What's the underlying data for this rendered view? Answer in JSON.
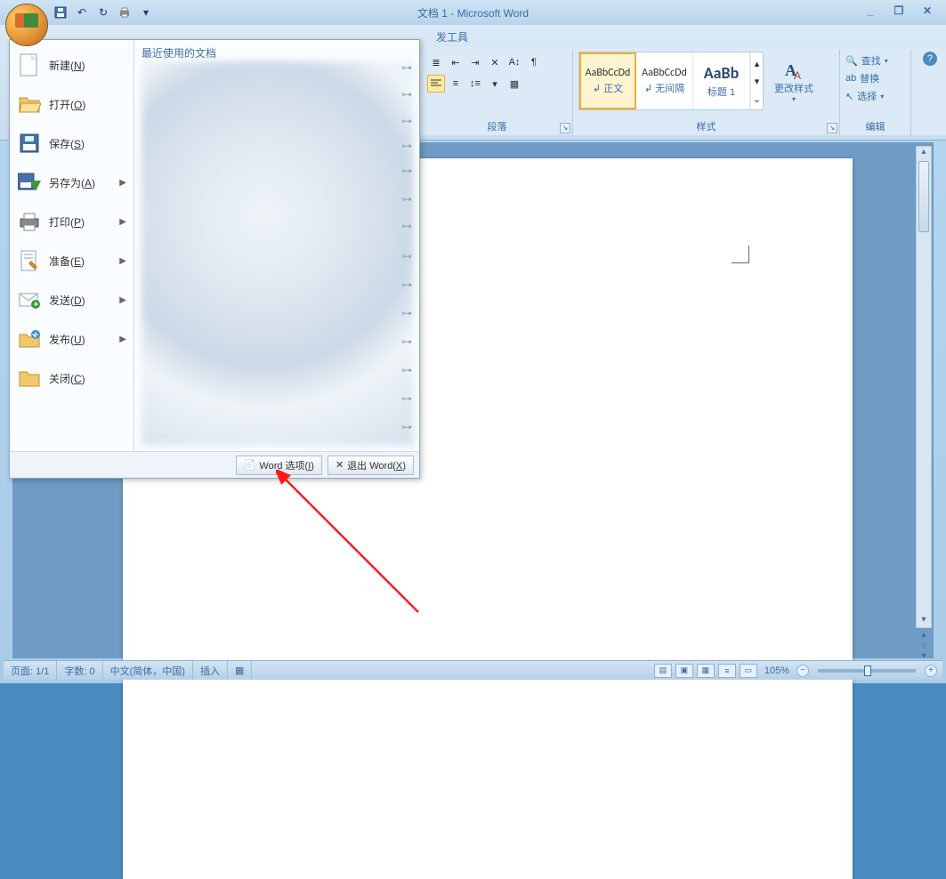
{
  "title": "文档 1 - Microsoft Word",
  "qat": {
    "save": "保存",
    "undo": "撤销",
    "redo": "恢复",
    "quick_print": "快速打印"
  },
  "ribbon": {
    "tab_visible": "发工具",
    "paragraph_label": "段落",
    "styles_label": "样式",
    "edit_label": "编辑",
    "styles": [
      {
        "sample": "AaBbCcDd",
        "name": "↲ 正文"
      },
      {
        "sample": "AaBbCcDd",
        "name": "↲ 无间隔"
      },
      {
        "sample": "AaBb",
        "name": "标题 1"
      }
    ],
    "change_style": "更改样式",
    "find": "查找",
    "replace": "替换",
    "select": "选择"
  },
  "help_tip": "?",
  "office_menu": {
    "recent_title": "最近使用的文档",
    "items": [
      {
        "label": "新建(N)"
      },
      {
        "label": "打开(O)"
      },
      {
        "label": "保存(S)"
      },
      {
        "label": "另存为(A)",
        "arrow": true
      },
      {
        "label": "打印(P)",
        "arrow": true
      },
      {
        "label": "准备(E)",
        "arrow": true
      },
      {
        "label": "发送(D)",
        "arrow": true
      },
      {
        "label": "发布(U)",
        "arrow": true
      },
      {
        "label": "关闭(C)"
      }
    ],
    "options_btn": "Word 选项(I)",
    "exit_btn": "退出 Word(X)"
  },
  "statusbar": {
    "page": "页面: 1/1",
    "words": "字数: 0",
    "lang": "中文(简体，中国)",
    "insert": "插入",
    "zoom": "105%"
  },
  "window_controls": {
    "min": "_",
    "max": "❐",
    "close": "✕"
  }
}
